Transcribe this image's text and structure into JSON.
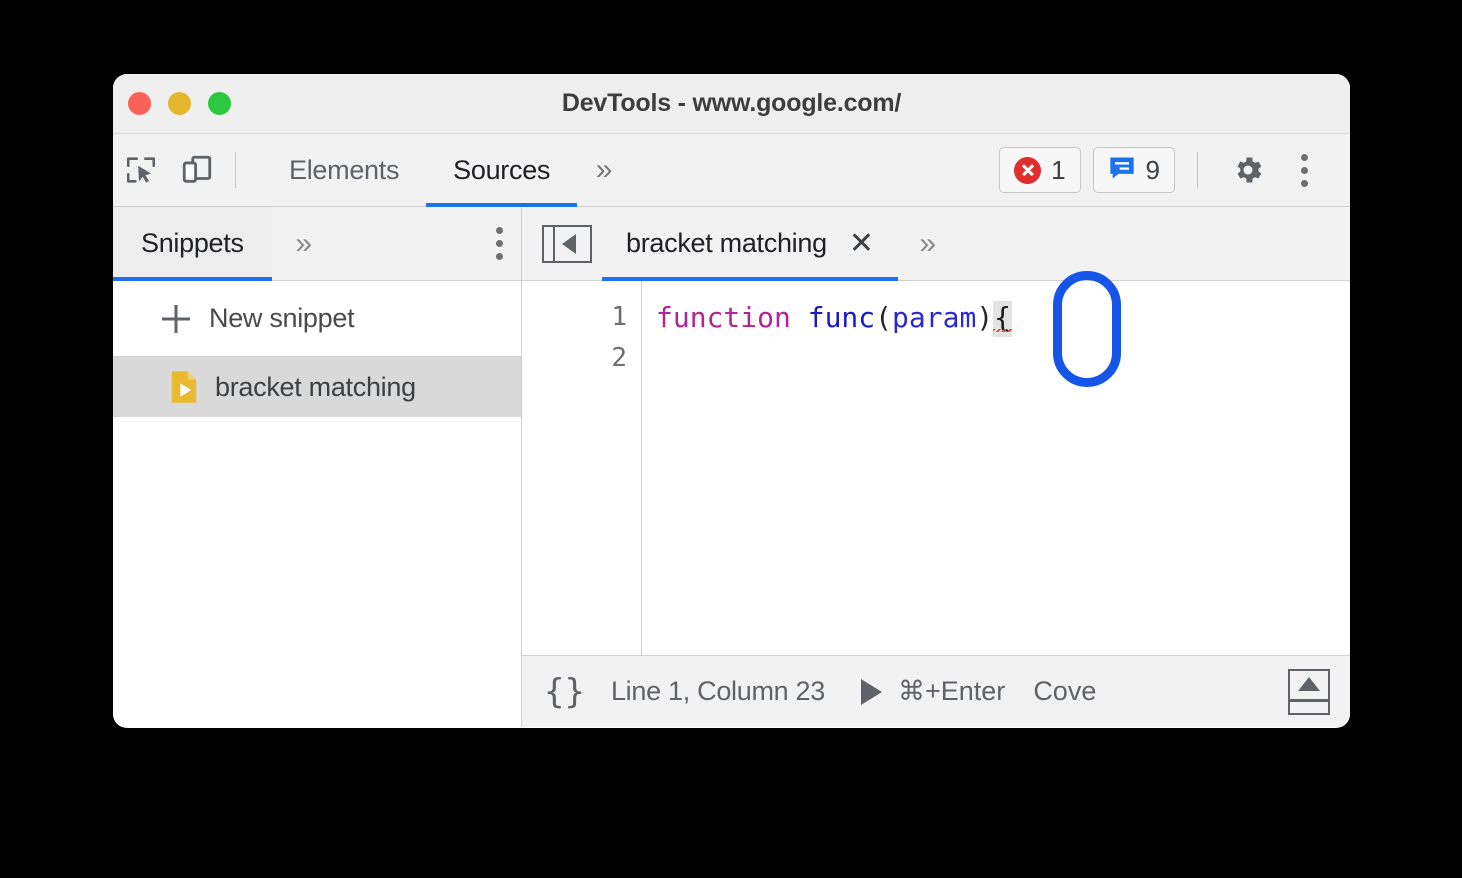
{
  "window": {
    "title": "DevTools - www.google.com/",
    "traffic_lights": [
      {
        "name": "close",
        "color": "#fc6157"
      },
      {
        "name": "minimize",
        "color": "#e4b62c"
      },
      {
        "name": "maximize",
        "color": "#2bc840"
      }
    ]
  },
  "toolbar": {
    "inspect_icon": "inspect-element-icon",
    "device_icon": "device-toolbar-icon",
    "tabs": [
      {
        "label": "Elements",
        "active": false
      },
      {
        "label": "Sources",
        "active": true
      }
    ],
    "overflow_chevron": "»",
    "error_badge": {
      "icon": "error-circle-icon",
      "count": "1",
      "color": "#e02d2d"
    },
    "message_badge": {
      "icon": "message-bubble-icon",
      "count": "9",
      "color": "#1a73e8"
    },
    "settings_icon": "gear-icon",
    "more_icon": "kebab-menu-icon"
  },
  "sidebar": {
    "tab_label": "Snippets",
    "overflow_chevron": "»",
    "more_icon": "kebab-menu-icon",
    "new_snippet_label": "New snippet",
    "items": [
      {
        "label": "bracket matching",
        "icon": "snippet-file-icon",
        "selected": true
      }
    ]
  },
  "editor": {
    "collapse_icon": "collapse-sidebar-icon",
    "tab": {
      "label": "bracket matching",
      "close": "✕"
    },
    "overflow_chevron": "»",
    "line_numbers": [
      "1",
      "2"
    ],
    "code_line_1": {
      "keyword": "function",
      "space": " ",
      "fn_name": "func",
      "open_paren": "(",
      "param": "param",
      "close_paren": ")",
      "brace": "{"
    }
  },
  "statusbar": {
    "pretty_print_icon": "{}",
    "cursor_position": "Line 1, Column 23",
    "run_icon": "play-icon",
    "run_shortcut": "⌘+Enter",
    "coverage_label": "Cove",
    "drawer_icon": "drawer-toggle-icon"
  },
  "annotation": {
    "shape": "rounded-rect-highlight",
    "color": "#1555e8",
    "target": "unmatched-open-brace"
  }
}
